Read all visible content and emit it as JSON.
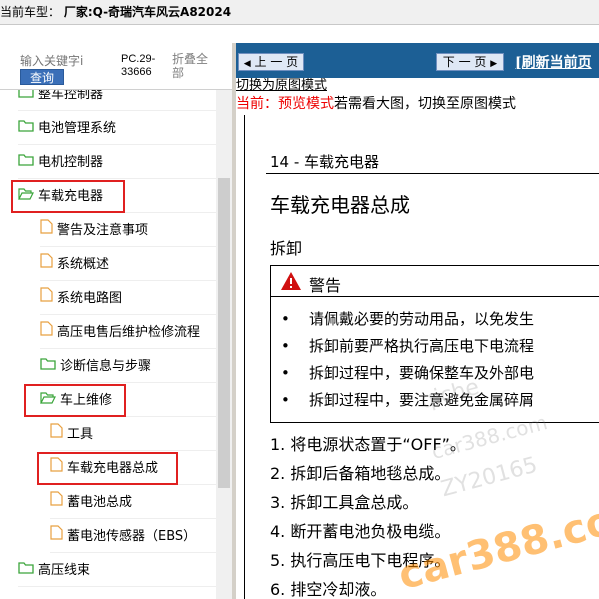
{
  "titlebar": {
    "prefix": "当前车型：",
    "maker": "厂家:Q-奇瑞汽车风云A82024"
  },
  "search": {
    "placeholder": "输入关键字i",
    "button": "查询",
    "pc_code": "PC.29-33666",
    "collapse": "折叠全部"
  },
  "tree": [
    {
      "label": "整车控制器",
      "type": "folder"
    },
    {
      "label": "电池管理系统",
      "type": "folder"
    },
    {
      "label": "电机控制器",
      "type": "folder"
    },
    {
      "label": "车载充电器",
      "type": "folder-open",
      "highlighted": true
    },
    {
      "label": "警告及注意事项",
      "type": "page"
    },
    {
      "label": "系统概述",
      "type": "page"
    },
    {
      "label": "系统电路图",
      "type": "page"
    },
    {
      "label": "高压电售后维护检修流程",
      "type": "page"
    },
    {
      "label": "诊断信息与步骤",
      "type": "folder"
    },
    {
      "label": "车上维修",
      "type": "folder-open",
      "highlighted": true
    },
    {
      "label": "工具",
      "type": "page"
    },
    {
      "label": "车载充电器总成",
      "type": "page",
      "highlighted": true
    },
    {
      "label": "蓄电池总成",
      "type": "page"
    },
    {
      "label": "蓄电池传感器（EBS）",
      "type": "page"
    },
    {
      "label": "高压线束",
      "type": "folder"
    }
  ],
  "nav": {
    "prev": "上 一 页",
    "next": "下 一 页",
    "refresh": "[刷新当前页"
  },
  "switch_link": "切换为原图模式",
  "mode": {
    "prefix": "当前：",
    "mode": "预览模式",
    "suffix": "若需看大图，切换至原图模式"
  },
  "doc": {
    "section": "14 - 车载充电器",
    "title": "车载充电器总成",
    "subtitle": "拆卸",
    "warning_title": "警告",
    "warnings": [
      "请佩戴必要的劳动用品，以免发生",
      "拆卸前要严格执行高压电下电流程",
      "拆卸过程中，要确保整车及外部电",
      "拆卸过程中，要注意避免金属碎屑"
    ],
    "steps": [
      "1.  将电源状态置于“OFF”。",
      "2.  拆卸后备箱地毯总成。",
      "3.  拆卸工具盒总成。",
      "4.  断开蓄电池负极电缆。",
      "5.  执行高压电下电程序。",
      "6.  排空冷却液。"
    ]
  },
  "watermarks": [
    "qiche",
    "car388.com",
    "ZY20165"
  ],
  "colors": {
    "nav_bg": "#1c5f95",
    "highlight": "#e02020",
    "folder": "#3aa53a",
    "page": "#e8a040",
    "warn": "#d01010"
  }
}
